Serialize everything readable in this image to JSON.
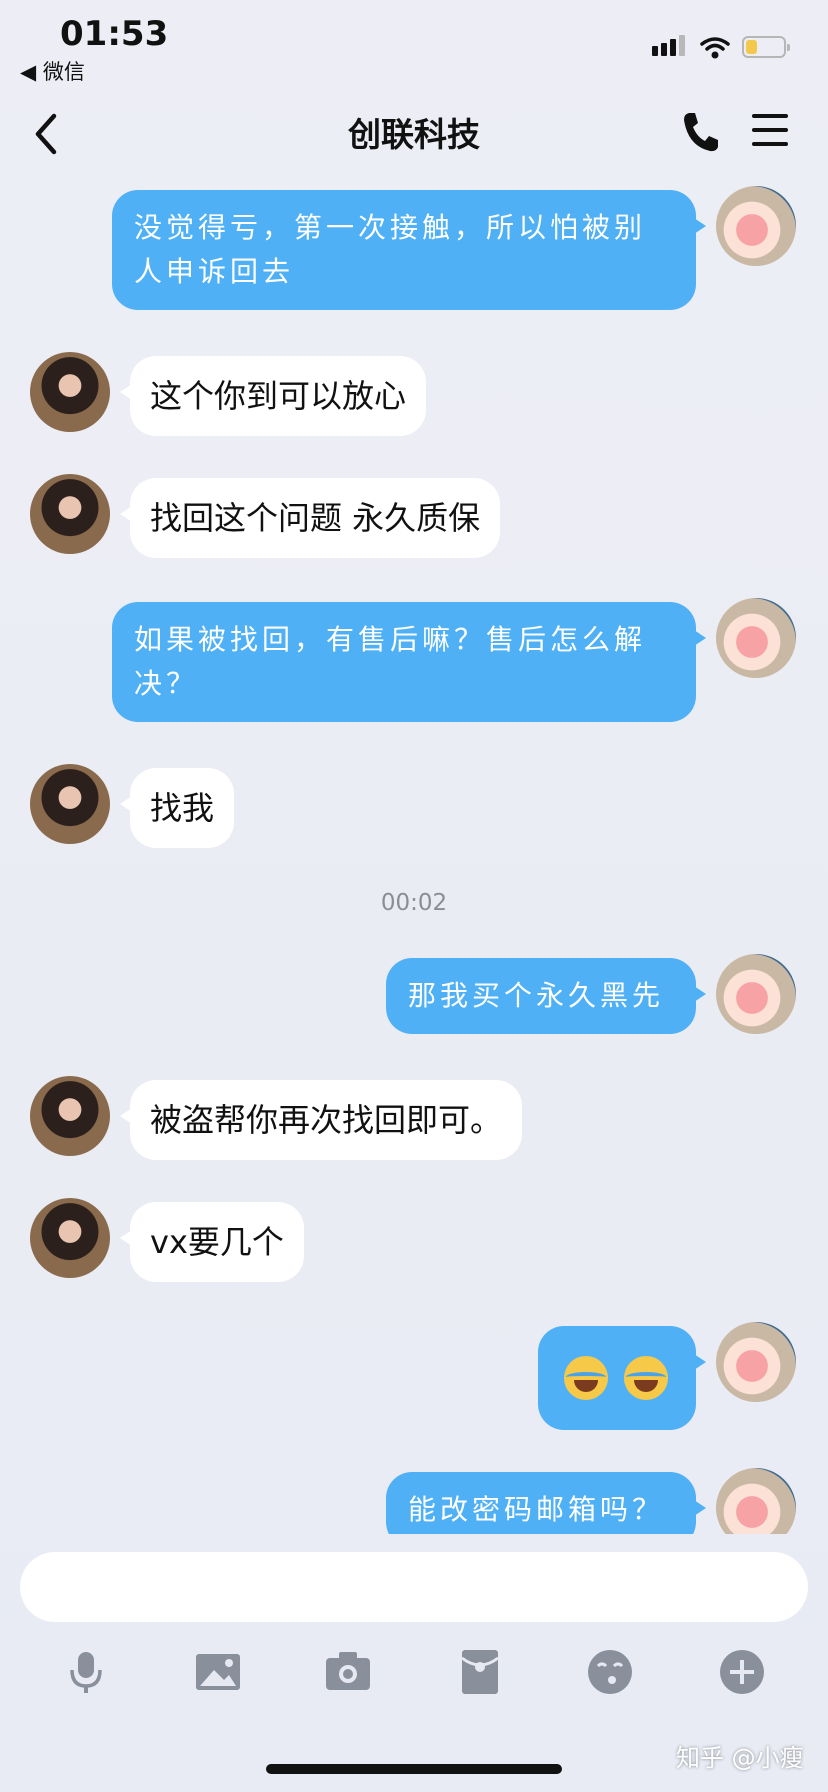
{
  "status_bar": {
    "time": "01:53",
    "back_app": "◀ 微信"
  },
  "nav": {
    "title": "创联科技"
  },
  "messages": [
    {
      "sender": "me",
      "text": "没觉得亏，第一次接触，所以怕被别人申诉回去"
    },
    {
      "sender": "other",
      "text": "这个你到可以放心"
    },
    {
      "sender": "other",
      "text": "找回这个问题 永久质保"
    },
    {
      "sender": "me",
      "text": "如果被找回，有售后嘛？售后怎么解决？"
    },
    {
      "sender": "other",
      "text": "找我"
    },
    {
      "type": "timestamp",
      "text": "00:02"
    },
    {
      "sender": "me",
      "text": "那我买个永久黑先"
    },
    {
      "sender": "other",
      "text": "被盗帮你再次找回即可。"
    },
    {
      "sender": "other",
      "text": "vx要几个"
    },
    {
      "sender": "me",
      "emoji": [
        "face-with-tears-of-joy",
        "face-with-tears-of-joy"
      ]
    },
    {
      "sender": "me",
      "text": "能改密码邮箱吗？"
    }
  ],
  "input": {
    "value": "",
    "placeholder": ""
  },
  "toolbar": {
    "icons": [
      "microphone-icon",
      "image-icon",
      "camera-icon",
      "red-packet-icon",
      "emoji-icon",
      "plus-icon"
    ]
  },
  "watermark": "知乎 @小瘦",
  "colors": {
    "bubble_me": "#4fb0f5",
    "bubble_other": "#ffffff",
    "background": "#e9ecf5"
  }
}
